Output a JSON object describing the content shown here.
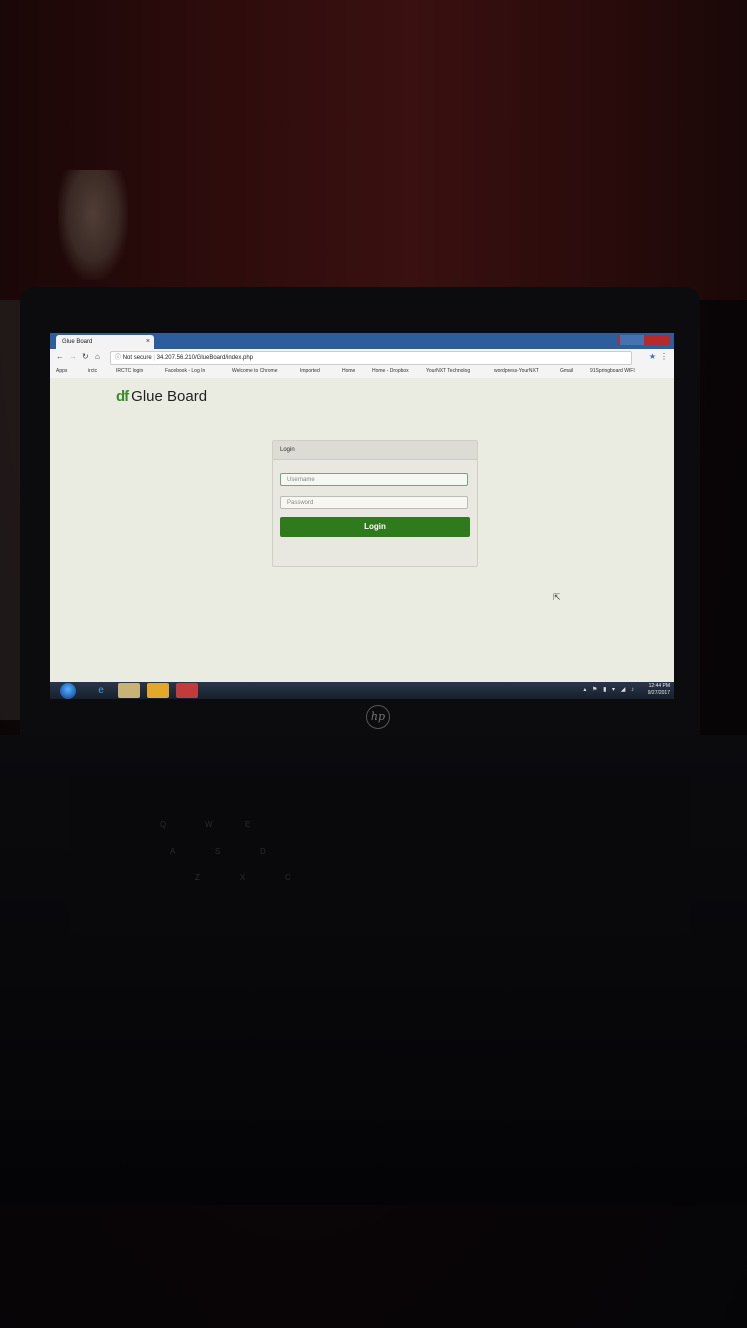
{
  "browser": {
    "tab_title": "Glue Board",
    "tab_close": "×",
    "not_secure": "Not secure",
    "url": "34.207.56.210/GlueBoard/index.php",
    "bookmarks": [
      "Apps",
      "irctc",
      "IRCTC login",
      "Facebook - Log In",
      "Welcome to Chrome",
      "Imported",
      "Home",
      "Home - Dropbox",
      "YourNXT Technolog",
      "wordpress-YourNXT",
      "Gmail",
      "91Springboard WIFI"
    ]
  },
  "page": {
    "logo_mark": "df",
    "logo_text": "Glue Board",
    "login_panel": {
      "title": "Login",
      "username_placeholder": "Username",
      "password_placeholder": "Password",
      "login_button": "Login"
    }
  },
  "taskbar": {
    "time": "12:44 PM",
    "date": "9/27/2017"
  },
  "device": {
    "brand_logo": "hp"
  },
  "colors": {
    "brand_green": "#3a8a2f",
    "login_button": "#2f7a1c",
    "chrome_frame": "#2d5d9c"
  }
}
